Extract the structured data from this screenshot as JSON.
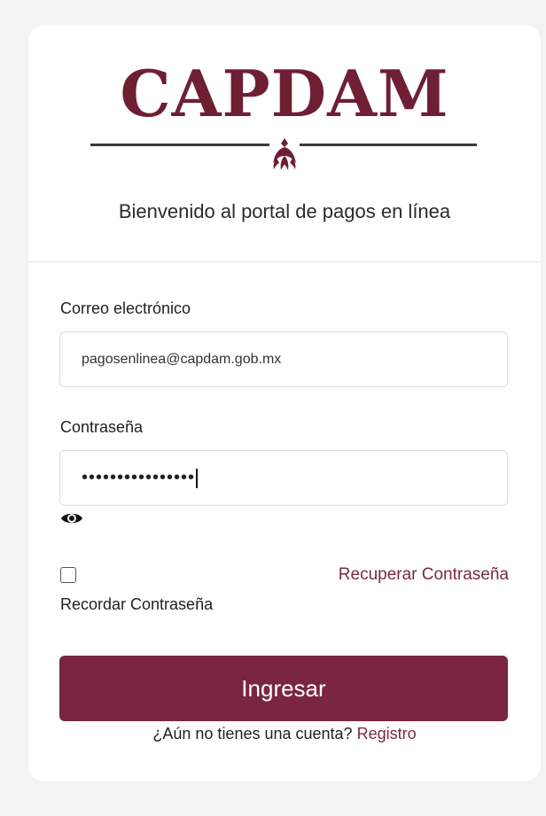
{
  "header": {
    "logo_text": "CAPDAM",
    "welcome": "Bienvenido al portal de pagos en línea"
  },
  "form": {
    "email_label": "Correo electrónico",
    "email_value": "pagosenlinea@capdam.gob.mx",
    "password_label": "Contraseña",
    "password_masked": "••••••••••••••••",
    "show_password_icon": "eye-icon",
    "remember_checked": false,
    "remember_label": "Recordar Contraseña",
    "recover_link": "Recuperar Contraseña",
    "submit_label": "Ingresar",
    "register_prompt": "¿Aún no tienes una cuenta?",
    "register_link": "Registro"
  },
  "colors": {
    "brand": "#7a2640",
    "logo": "#6e1f33",
    "background": "#f3f3f4"
  }
}
